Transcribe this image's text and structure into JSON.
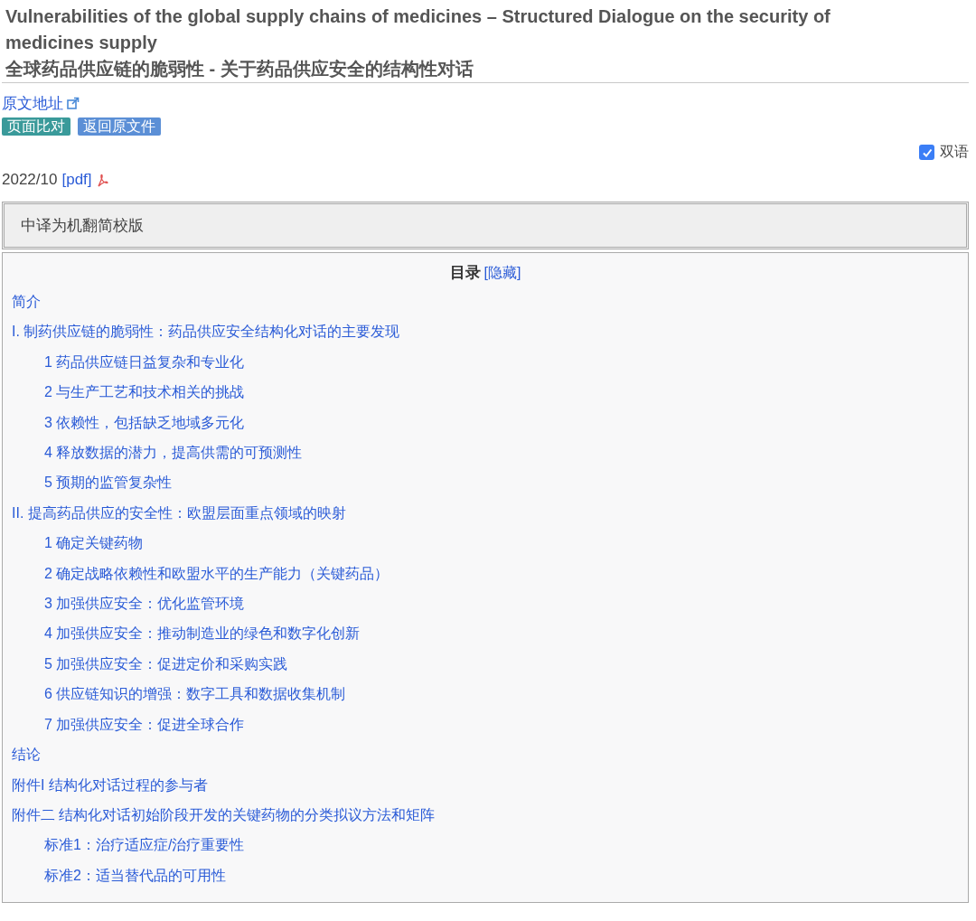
{
  "title": {
    "english": "Vulnerabilities of the global supply chains of medicines – Structured Dialogue on the security of medicines supply",
    "chinese": "全球药品供应链的脆弱性 - 关于药品供应安全的结构性对话"
  },
  "source_link": "原文地址",
  "buttons": [
    {
      "label": "页面比对",
      "color": "#3a9a9a"
    },
    {
      "label": "返回原文件",
      "color": "#5b8fd6"
    }
  ],
  "bilingual": {
    "label": "双语",
    "checked": true
  },
  "date": "2022/10",
  "pdf_link": "[pdf]",
  "notice": "中译为机翻简校版",
  "toc": {
    "title": "目录",
    "toggle": "[隐藏]",
    "items": [
      {
        "label": "简介"
      },
      {
        "label": "I. 制药供应链的脆弱性：药品供应安全结构化对话的主要发现",
        "children": [
          {
            "label": "1 药品供应链日益复杂和专业化"
          },
          {
            "label": "2 与生产工艺和技术相关的挑战"
          },
          {
            "label": "3 依赖性，包括缺乏地域多元化"
          },
          {
            "label": "4 释放数据的潜力，提高供需的可预测性"
          },
          {
            "label": "5 预期的监管复杂性"
          }
        ]
      },
      {
        "label": "II. 提高药品供应的安全性：欧盟层面重点领域的映射",
        "children": [
          {
            "label": "1 确定关键药物"
          },
          {
            "label": "2 确定战略依赖性和欧盟水平的生产能力（关键药品）"
          },
          {
            "label": "3 加强供应安全：优化监管环境"
          },
          {
            "label": "4 加强供应安全：推动制造业的绿色和数字化创新"
          },
          {
            "label": "5 加强供应安全：促进定价和采购实践"
          },
          {
            "label": "6 供应链知识的增强：数字工具和数据收集机制"
          },
          {
            "label": "7 加强供应安全：促进全球合作"
          }
        ]
      },
      {
        "label": "结论"
      },
      {
        "label": "附件I 结构化对话过程的参与者"
      },
      {
        "label": "附件二 结构化对话初始阶段开发的关键药物的分类拟议方法和矩阵",
        "children": [
          {
            "label": "标准1：治疗适应症/治疗重要性"
          },
          {
            "label": "标准2：适当替代品的可用性"
          }
        ]
      }
    ]
  }
}
